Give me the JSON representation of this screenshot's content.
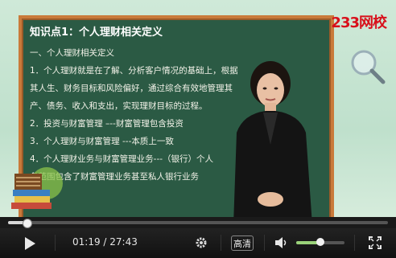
{
  "brand": {
    "text": "233网校",
    "color": "#d8101b"
  },
  "board": {
    "title": "知识点1：个人理财相关定义",
    "lines": [
      "一、个人理财相关定义",
      "1．个人理财就是在了解、分析客户情况的基础上，根据",
      "其人生、财务目标和风险偏好，通过综合有效地管理其",
      "产、债务、收入和支出，实现理财目标的过程。",
      "2．投资与财富管理 –--财富管理包含投资",
      "3．个人理财与财富管理 ---本质上一致",
      "4．个人理财业务与财富管理业务---（银行）个人",
      "务范围包含了财富管理业务甚至私人银行业务"
    ]
  },
  "player": {
    "current_time": "01:19",
    "duration": "27:43",
    "time_separator": " / ",
    "progress_fraction": 0.048,
    "hd_label": "高清",
    "volume_fraction": 0.5,
    "icons": [
      "play-icon",
      "settings-gear-icon",
      "volume-icon",
      "fullscreen-icon"
    ]
  }
}
